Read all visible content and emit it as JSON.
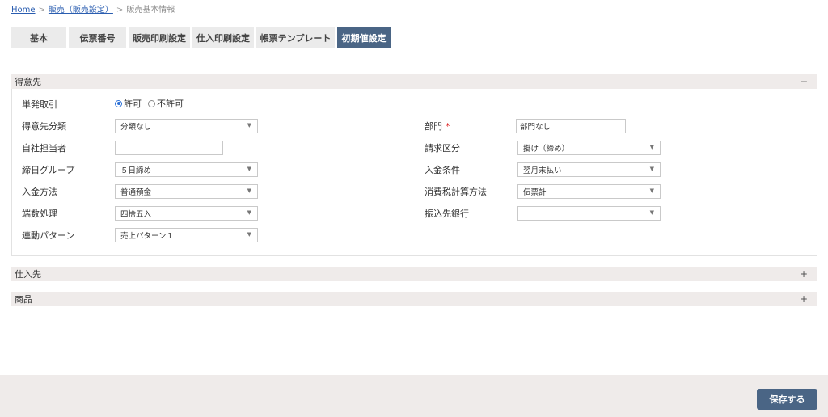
{
  "breadcrumb": {
    "home": "Home",
    "sep": ">",
    "sales": "販売（販売設定）",
    "current": "販売基本情報"
  },
  "tabs": [
    {
      "label": "基本"
    },
    {
      "label": "伝票番号"
    },
    {
      "label": "販売印刷設定"
    },
    {
      "label": "仕入印刷設定"
    },
    {
      "label": "帳票テンプレート"
    },
    {
      "label": "初期値設定",
      "active": true
    }
  ],
  "sections": {
    "customer": {
      "title": "得意先",
      "toggle": "−",
      "fields": {
        "single_trade": {
          "label": "単発取引",
          "options": [
            "許可",
            "不許可"
          ],
          "selected": "許可"
        },
        "customer_class": {
          "label": "得意先分類",
          "value": "分類なし"
        },
        "staff": {
          "label": "自社担当者",
          "value": ""
        },
        "closing_group": {
          "label": "締日グループ",
          "value": "５日締め"
        },
        "payment_method": {
          "label": "入金方法",
          "value": "普通預金"
        },
        "rounding": {
          "label": "端数処理",
          "value": "四捨五入"
        },
        "link_pattern": {
          "label": "連動パターン",
          "value": "売上パターン１"
        },
        "department": {
          "label": "部門",
          "required_mark": "*",
          "value": "部門なし"
        },
        "billing_type": {
          "label": "請求区分",
          "value": "掛け（締め）"
        },
        "payment_terms": {
          "label": "入金条件",
          "value": "翌月末払い"
        },
        "tax_calc": {
          "label": "消費税計算方法",
          "value": "伝票計"
        },
        "transfer_bank": {
          "label": "振込先銀行",
          "value": ""
        }
      }
    },
    "supplier": {
      "title": "仕入先",
      "toggle": "+"
    },
    "product": {
      "title": "商品",
      "toggle": "+"
    }
  },
  "footer": {
    "save_label": "保存する"
  },
  "icons": {
    "dropdown": "chevron-down-icon"
  },
  "colors": {
    "accent": "#4a6585",
    "link": "#2a5db0",
    "required": "#dd2222"
  }
}
